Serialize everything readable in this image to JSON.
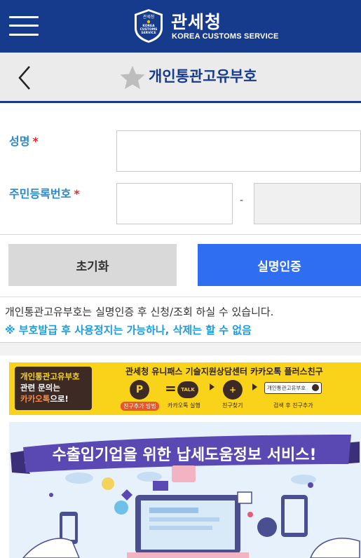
{
  "header": {
    "brand": "관세청",
    "brand_sub": "KOREA CUSTOMS SERVICE",
    "emblem_text": [
      "관세청",
      "KOREA",
      "CUSTOMS",
      "SERVICE"
    ],
    "menu_icon": "hamburger-icon",
    "colors": {
      "primary": "#163a8c"
    }
  },
  "subheader": {
    "title": "개인통관고유부호",
    "back_icon": "chevron-left-icon",
    "favorite_icon": "star-icon"
  },
  "form": {
    "name_label": "성명",
    "id_label": "주민등록번호",
    "required_mark": "*",
    "id_separator": "-",
    "name_value": "",
    "id_front_value": "",
    "id_back_value": ""
  },
  "buttons": {
    "reset": "초기화",
    "verify": "실명인증",
    "colors": {
      "verify": "#2f6ef0",
      "reset": "#d9d9d9"
    }
  },
  "notice": {
    "line1": "개인통관고유부호는 실명인증 후 신청/조회 하실 수 있습니다.",
    "line2": "※ 부호발급 후 사용정지는 가능하나, 삭제는 할 수 없음"
  },
  "kakao_banner": {
    "box_line1": "개인통관고유부호",
    "box_line2": "관련 문의는",
    "box_line3_a": "카카오톡",
    "box_line3_b": "으로!",
    "headline": "관세청 유니패스 기술지원상담센터 카카오톡 플러스친구",
    "step0_chip": "친구추가 방법",
    "step1": "카카오톡 실행",
    "step2": "친구찾기",
    "step3": "검색 후 친구추가",
    "search_text": "개인통관고유부호",
    "p_logo": "P",
    "talk_logo": "TALK",
    "equals": "="
  },
  "poster": {
    "title": "수출입기업을 위한 납세도움정보 서비스!"
  }
}
